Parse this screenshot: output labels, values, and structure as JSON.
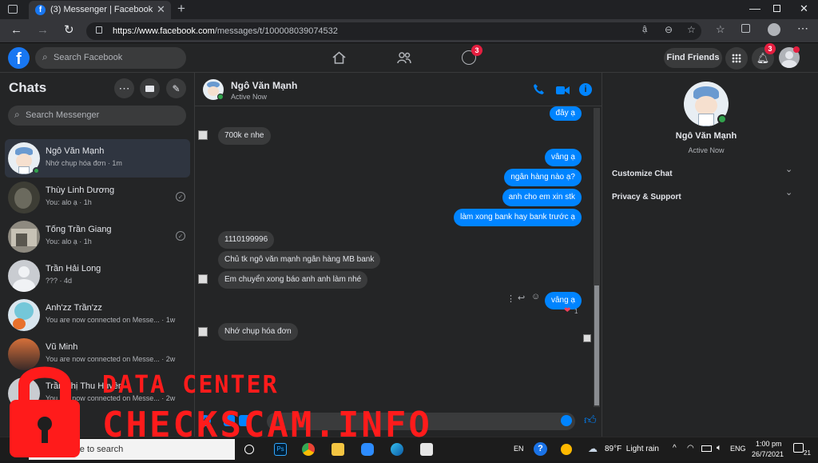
{
  "browser": {
    "tab_title": "(3) Messenger | Facebook",
    "url_prefix": "https://www.facebook.com",
    "url_path": "/messages/t/100008039074532"
  },
  "fb": {
    "search_placeholder": "Search Facebook",
    "find_friends": "Find Friends",
    "groups_badge": "3",
    "notif_badge": "3"
  },
  "sidebar": {
    "title": "Chats",
    "search_placeholder": "Search Messenger",
    "chats": [
      {
        "name": "Ngô Văn Mạnh",
        "sub": "Nhớ chụp hóa đơn · 1m"
      },
      {
        "name": "Thùy Linh Dương",
        "sub": "You: alo ạ · 1h"
      },
      {
        "name": "Tống Trần Giang",
        "sub": "You: alo ạ · 1h"
      },
      {
        "name": "Trần Hải Long",
        "sub": "??? · 4d"
      },
      {
        "name": "Anh'zz Trần'zz",
        "sub": "You are now connected on Messe... · 1w"
      },
      {
        "name": "Vũ Minh",
        "sub": "You are now connected on Messe... · 2w"
      },
      {
        "name": "Trần Thị Thu Huyền",
        "sub": "You are now connected on Messe... · 2w"
      }
    ]
  },
  "conversation": {
    "name": "Ngô Văn Mạnh",
    "status": "Active Now",
    "messages": {
      "m1": "đây ạ",
      "m2": "700k e nhe",
      "m3": "vâng ạ",
      "m4": "ngân hàng nào ạ?",
      "m5": "anh cho em xin stk",
      "m6": "làm xong bank hay bank trước ạ",
      "m7": "1110199996",
      "m8": "Chủ tk ngô văn mạnh ngân hàng MB bank",
      "m9": "Em chuyển xong báo anh anh làm nhé",
      "m10": "vâng ạ",
      "m11": "Nhớ chụp hóa đơn"
    },
    "reaction_count": "1"
  },
  "info": {
    "name": "Ngô Văn Mạnh",
    "status": "Active Now",
    "customize": "Customize Chat",
    "privacy": "Privacy & Support"
  },
  "taskbar": {
    "search": "ere to search",
    "lang": "EN",
    "weather": "89°F  Light rain",
    "input_lang": "ENG",
    "time": "1:00 pm",
    "date": "26/7/2021",
    "notif_count": "21"
  },
  "watermark": {
    "line1": "DATA CENTER",
    "line2": "CHECKSCAM.INFO"
  },
  "colors": {
    "accent": "#0084ff",
    "bg": "#18191a",
    "panel": "#242526",
    "watermark": "#ff1b1b"
  }
}
